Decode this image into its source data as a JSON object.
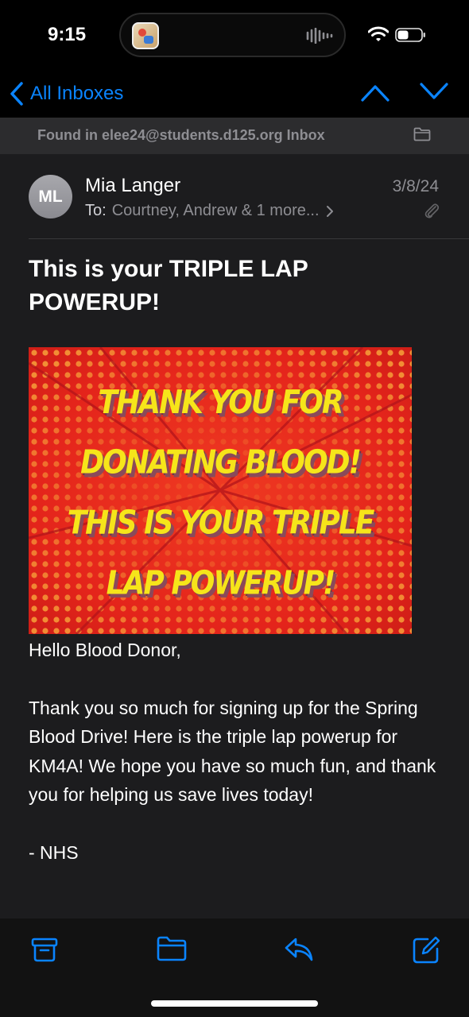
{
  "status_bar": {
    "time": "9:15",
    "icons": [
      "app-thumbnail-icon",
      "audio-waveform-icon",
      "wifi-icon",
      "battery-icon"
    ]
  },
  "nav": {
    "back_label": "All Inboxes",
    "accent_color": "#0a84ff"
  },
  "found_bar": {
    "text": "Found in elee24@students.d125.org Inbox"
  },
  "message": {
    "avatar_initials": "ML",
    "sender": "Mia Langer",
    "date": "3/8/24",
    "to_label": "To:",
    "to_recipients": "Courtney, Andrew & 1 more...",
    "subject": "This is your TRIPLE LAP POWERUP!",
    "banner": {
      "lines": [
        "THANK YOU FOR",
        "DONATING BLOOD!",
        "THIS IS YOUR TRIPLE",
        "LAP POWERUP!"
      ],
      "background_color": "#e4241b",
      "text_color": "#f6e51a"
    },
    "greeting": "Hello Blood Donor,",
    "body": "Thank you so much for signing up for the Spring Blood Drive! Here is the triple lap powerup for KM4A! We hope you have so much fun, and thank you for helping us save lives today!",
    "signature": "- NHS"
  },
  "toolbar": {
    "icons": [
      "archive-icon",
      "folder-icon",
      "reply-icon",
      "compose-icon"
    ]
  }
}
